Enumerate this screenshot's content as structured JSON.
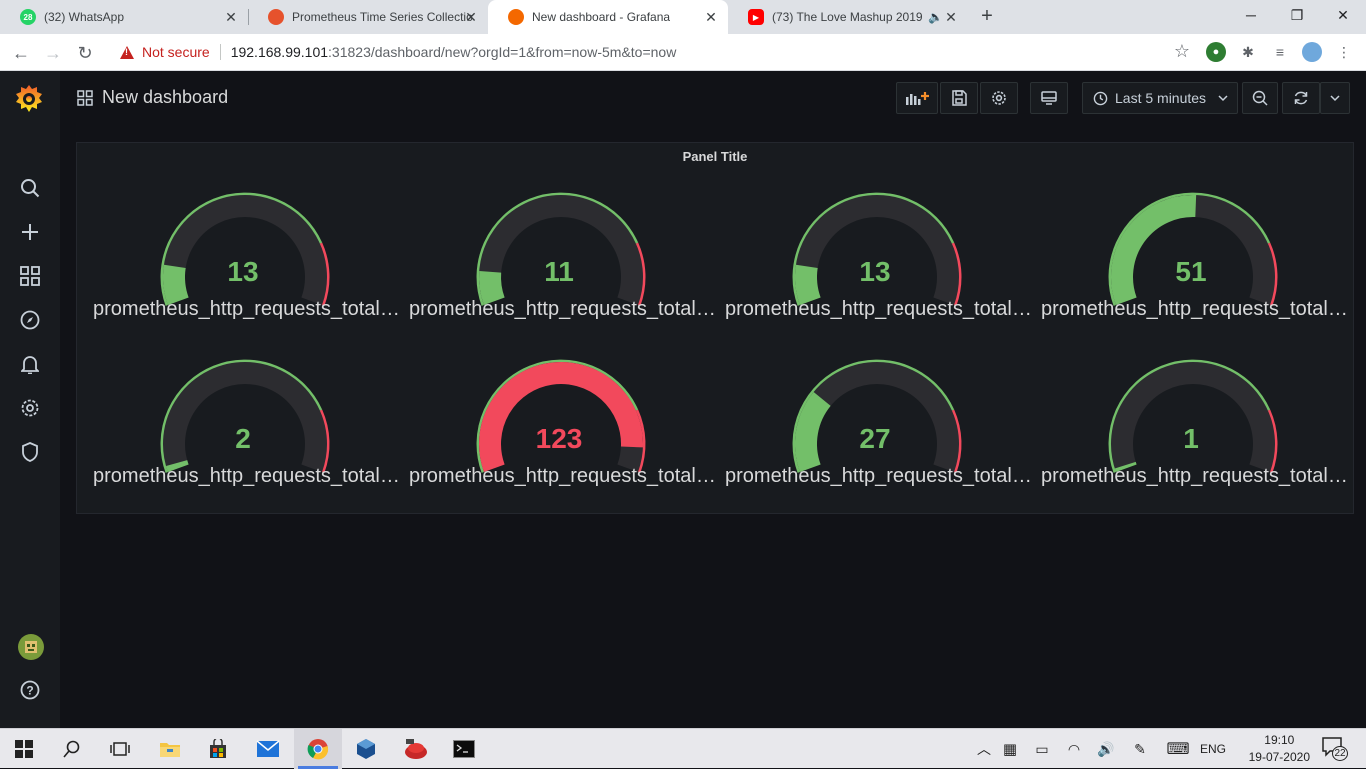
{
  "browser": {
    "tabs": [
      {
        "title": "(32) WhatsApp",
        "badge": "28",
        "favicon": "whatsapp-icon",
        "color": "#25d366"
      },
      {
        "title": "Prometheus Time Series Collectio",
        "favicon": "prometheus-icon",
        "color": "#e6522c"
      },
      {
        "title": "New dashboard - Grafana",
        "favicon": "grafana-icon",
        "color": "#f46800"
      },
      {
        "title": "(73) The Love Mashup 2019 /",
        "favicon": "youtube-icon",
        "color": "#ff0000"
      }
    ],
    "active_tab_index": 2,
    "security_label": "Not secure",
    "url_host": "192.168.99.101",
    "url_rest": ":31823/dashboard/new?orgId=1&from=now-5m&to=now"
  },
  "grafana": {
    "dashboard_title": "New dashboard",
    "time_range_label": "Last 5 minutes",
    "panel": {
      "title": "Panel Title",
      "gauges": [
        {
          "value": "13",
          "label": "prometheus_http_requests_total{...",
          "fraction": 0.13,
          "color": "#73bf69"
        },
        {
          "value": "11",
          "label": "prometheus_http_requests_total{...",
          "fraction": 0.11,
          "color": "#73bf69"
        },
        {
          "value": "13",
          "label": "prometheus_http_requests_total{...",
          "fraction": 0.13,
          "color": "#73bf69"
        },
        {
          "value": "51",
          "label": "prometheus_http_requests_total{...",
          "fraction": 0.51,
          "color": "#73bf69"
        },
        {
          "value": "2",
          "label": "prometheus_http_requests_total{...",
          "fraction": 0.02,
          "color": "#73bf69"
        },
        {
          "value": "123",
          "label": "prometheus_http_requests_total{...",
          "fraction": 0.92,
          "color": "#f2495c"
        },
        {
          "value": "27",
          "label": "prometheus_http_requests_total{...",
          "fraction": 0.27,
          "color": "#73bf69"
        },
        {
          "value": "1",
          "label": "prometheus_http_requests_total{...",
          "fraction": 0.01,
          "color": "#73bf69"
        }
      ],
      "threshold_colors": {
        "base": "#73bf69",
        "high": "#f2495c"
      }
    }
  },
  "taskbar": {
    "lang": "ENG",
    "time": "19:10",
    "date": "19-07-2020",
    "notification_count": "22"
  }
}
